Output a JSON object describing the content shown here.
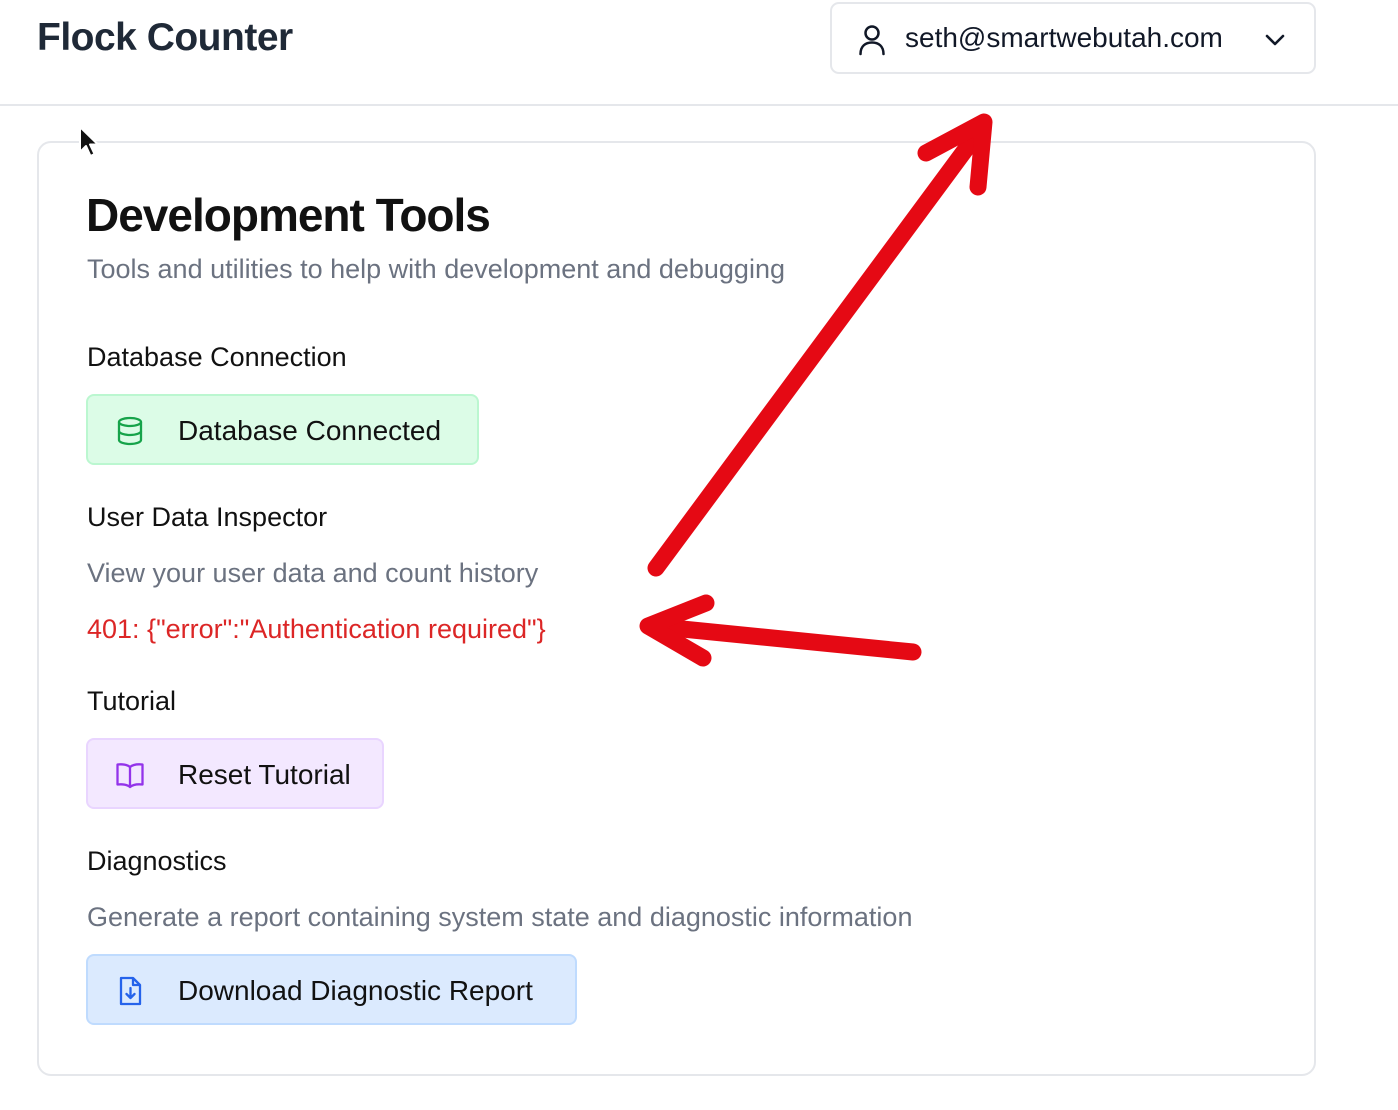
{
  "app": {
    "title": "Flock Counter"
  },
  "user_menu": {
    "email": "seth@smartwebutah.com",
    "icons": [
      "user-icon",
      "chevron-down-icon"
    ]
  },
  "card": {
    "title": "Development Tools",
    "subtitle": "Tools and utilities to help with development and debugging"
  },
  "sections": {
    "database": {
      "title": "Database Connection",
      "button_label": "Database Connected",
      "icon": "database-icon",
      "color": "#16a34a"
    },
    "inspector": {
      "title": "User Data Inspector",
      "description": "View your user data and count history",
      "error": "401: {\"error\":\"Authentication required\"}"
    },
    "tutorial": {
      "title": "Tutorial",
      "button_label": "Reset Tutorial",
      "icon": "book-open-icon",
      "color": "#9333ea"
    },
    "diagnostics": {
      "title": "Diagnostics",
      "description": "Generate a report containing system state and diagnostic information",
      "button_label": "Download Diagnostic Report",
      "icon": "file-download-icon",
      "color": "#2563eb"
    }
  },
  "annotations": {
    "arrow_color": "#e50914"
  }
}
